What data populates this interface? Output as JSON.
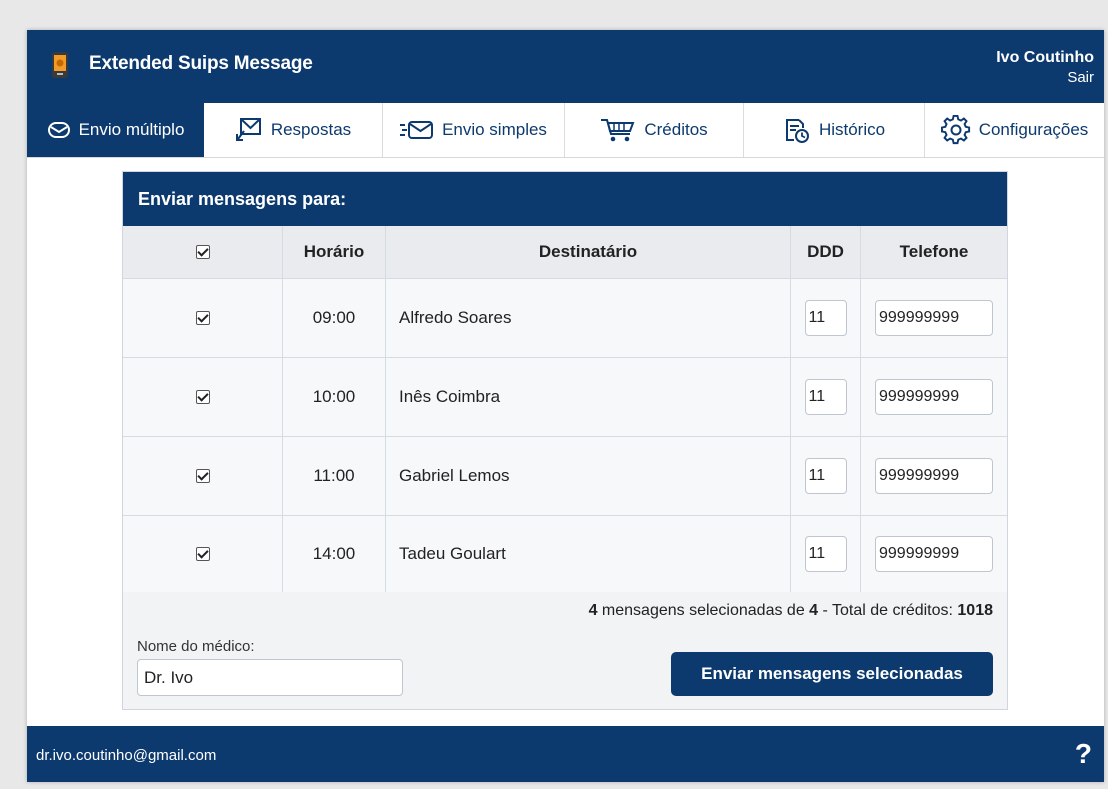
{
  "header": {
    "app_title": "Extended Suips Message",
    "user_name": "Ivo Coutinho",
    "logout_label": "Sair"
  },
  "tabs": [
    {
      "label": "Envio múltiplo",
      "icon": "envelope-icon",
      "active": true
    },
    {
      "label": "Respostas",
      "icon": "reply-envelope-icon",
      "active": false
    },
    {
      "label": "Envio simples",
      "icon": "send-envelope-icon",
      "active": false
    },
    {
      "label": "Créditos",
      "icon": "cart-icon",
      "active": false
    },
    {
      "label": "Histórico",
      "icon": "history-icon",
      "active": false
    },
    {
      "label": "Configurações",
      "icon": "gear-icon",
      "active": false
    }
  ],
  "panel": {
    "title": "Enviar mensagens para:",
    "columns": {
      "time": "Horário",
      "recipient": "Destinatário",
      "ddd": "DDD",
      "phone": "Telefone"
    },
    "rows": [
      {
        "checked": true,
        "time": "09:00",
        "recipient": "Alfredo Soares",
        "ddd": "11",
        "phone": "999999999"
      },
      {
        "checked": true,
        "time": "10:00",
        "recipient": "Inês Coimbra",
        "ddd": "11",
        "phone": "999999999"
      },
      {
        "checked": true,
        "time": "11:00",
        "recipient": "Gabriel Lemos",
        "ddd": "11",
        "phone": "999999999"
      },
      {
        "checked": true,
        "time": "14:00",
        "recipient": "Tadeu Goulart",
        "ddd": "11",
        "phone": "999999999"
      }
    ],
    "summary": {
      "selected": "4",
      "text1": " mensagens selecionadas de ",
      "total": "4",
      "text2": " - Total de créditos: ",
      "credits": "1018"
    },
    "doctor_label": "Nome do médico:",
    "doctor_value": "Dr. Ivo",
    "send_label": "Enviar mensagens selecionadas"
  },
  "footer": {
    "email": "dr.ivo.coutinho@gmail.com",
    "help": "?"
  },
  "colors": {
    "brand": "#0d3a6e",
    "panel_bg": "#f2f3f5"
  }
}
